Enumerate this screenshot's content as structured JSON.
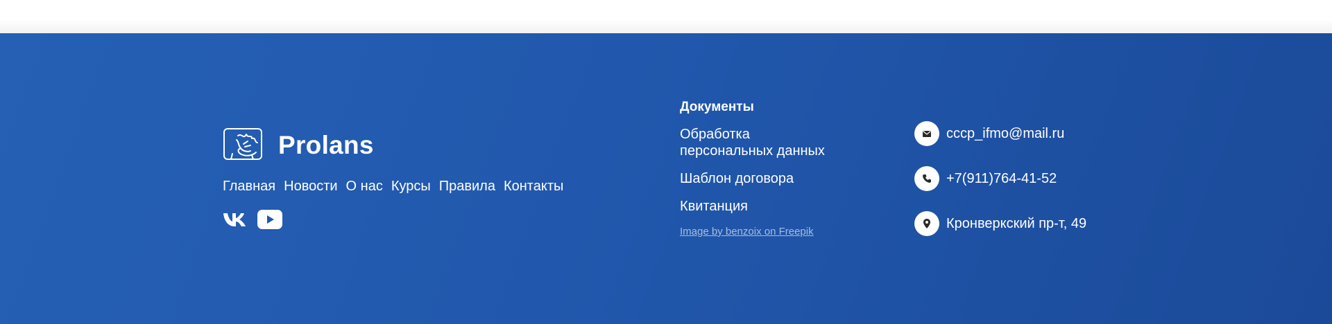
{
  "brand": {
    "name": "Prolans",
    "logo_icon": "prolans-logo-icon"
  },
  "nav": {
    "items": [
      {
        "label": "Главная"
      },
      {
        "label": "Новости"
      },
      {
        "label": "О нас"
      },
      {
        "label": "Курсы"
      },
      {
        "label": "Правила"
      },
      {
        "label": "Контакты"
      }
    ]
  },
  "social": {
    "vk_icon": "vk-icon",
    "youtube_icon": "youtube-icon"
  },
  "documents": {
    "title": "Документы",
    "links": [
      {
        "label": "Обработка персональных данных"
      },
      {
        "label": "Шаблон договора"
      },
      {
        "label": "Квитанция"
      }
    ],
    "credit": "Image by benzoix on Freepik"
  },
  "contacts": {
    "email": "cccp_ifmo@mail.ru",
    "phone": "+7(911)764-41-52",
    "address": "Кронверкский пр-т, 49"
  },
  "colors": {
    "footer_bg_start": "#2560b4",
    "footer_bg_end": "#1b4a99",
    "text": "#ffffff",
    "credit": "#a9bde0",
    "icon_circle": "#ffffff",
    "icon_glyph": "#2a2a2a"
  }
}
